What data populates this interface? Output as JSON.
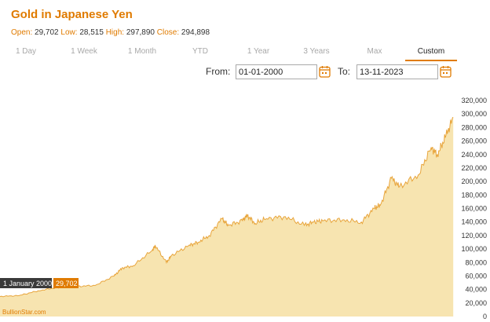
{
  "header": {
    "title": "Gold in Japanese Yen",
    "open_label": "Open:",
    "open": "29,702",
    "low_label": "Low:",
    "low": "28,515",
    "high_label": "High:",
    "high": "297,890",
    "close_label": "Close:",
    "close": "294,898"
  },
  "tabs": [
    {
      "label": "1 Day"
    },
    {
      "label": "1 Week"
    },
    {
      "label": "1 Month"
    },
    {
      "label": "YTD"
    },
    {
      "label": "1 Year"
    },
    {
      "label": "3 Years"
    },
    {
      "label": "Max"
    },
    {
      "label": "Custom",
      "active": true
    }
  ],
  "range": {
    "from_label": "From:",
    "from_value": "01-01-2000",
    "to_label": "To:",
    "to_value": "13-11-2023"
  },
  "colors": {
    "accent": "#e07b00",
    "area_fill": "#f7e4b0",
    "line": "#e8a53c",
    "tooltip_dark": "#3a3a3a"
  },
  "icons": {
    "calendar": "calendar-icon"
  },
  "tooltip": {
    "date": "1 January 2000",
    "value": "29,702"
  },
  "watermark": "BullionStar.com",
  "chart_data": {
    "type": "area",
    "title": "Gold in Japanese Yen",
    "x_range": [
      "2000-01-01",
      "2023-11-13"
    ],
    "ylim": [
      0,
      320000
    ],
    "yticks": [
      0,
      20000,
      40000,
      60000,
      80000,
      100000,
      120000,
      140000,
      160000,
      180000,
      200000,
      220000,
      240000,
      260000,
      280000,
      300000,
      320000
    ],
    "ytick_labels": [
      "0",
      "20,000",
      "40,000",
      "60,000",
      "80,000",
      "100,000",
      "120,000",
      "140,000",
      "160,000",
      "180,000",
      "200,000",
      "220,000",
      "240,000",
      "260,000",
      "280,000",
      "300,000",
      "320,000"
    ],
    "grid": false,
    "series": [
      {
        "x": [
          "2000-01",
          "2001-01",
          "2002-01",
          "2003-01",
          "2004-01",
          "2005-01",
          "2006-01",
          "2006-06",
          "2007-01",
          "2008-01",
          "2008-03",
          "2008-10",
          "2009-01",
          "2009-12",
          "2010-06",
          "2011-01",
          "2011-09",
          "2012-01",
          "2012-10",
          "2013-01",
          "2013-06",
          "2014-01",
          "2015-01",
          "2016-01",
          "2016-07",
          "2017-01",
          "2018-01",
          "2019-01",
          "2019-09",
          "2020-01",
          "2020-08",
          "2021-01",
          "2022-01",
          "2022-09",
          "2023-01",
          "2023-06",
          "2023-11"
        ],
        "y": [
          29702,
          31000,
          38000,
          43000,
          44500,
          46000,
          60000,
          72000,
          75000,
          98000,
          105000,
          80000,
          90000,
          105000,
          110000,
          120000,
          145000,
          135000,
          142000,
          150000,
          138000,
          145000,
          148000,
          135000,
          140000,
          142000,
          143000,
          140000,
          160000,
          165000,
          205000,
          192000,
          210000,
          250000,
          240000,
          265000,
          294898
        ]
      }
    ]
  }
}
